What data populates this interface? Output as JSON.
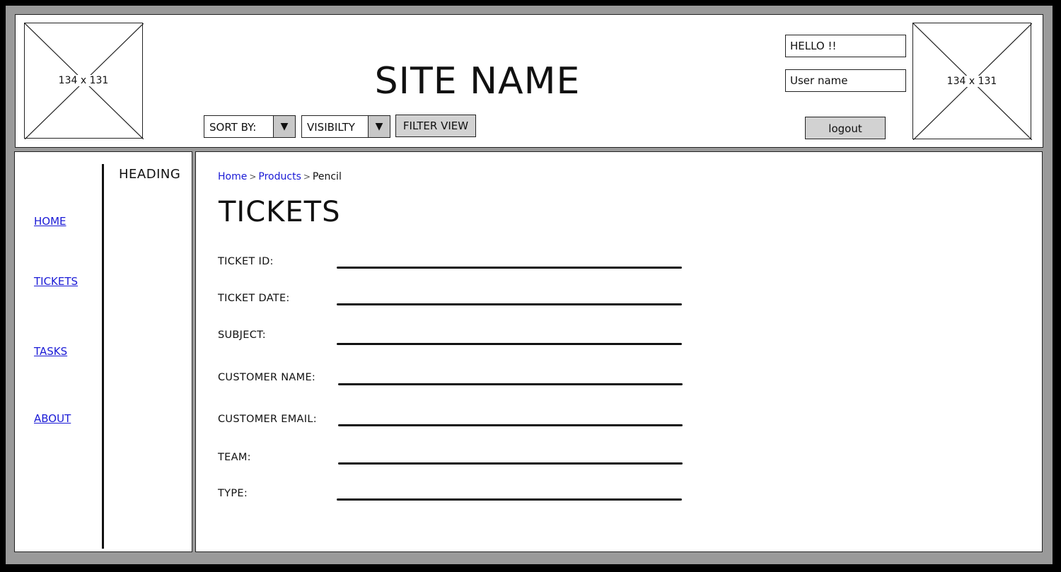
{
  "header": {
    "logo_left": {
      "label": "134 x 131"
    },
    "site_name": "SITE NAME",
    "sort_select": {
      "label": "SORT BY:",
      "arrow": "▼"
    },
    "visibility_select": {
      "label": "VISIBILTY",
      "arrow": "▼"
    },
    "filter_button": "FILTER VIEW",
    "greeting": "HELLO !!",
    "username": "User name",
    "logout_button": "logout",
    "avatar_right": {
      "label": "134 x 131"
    }
  },
  "sidebar": {
    "heading": "HEADING",
    "items": [
      {
        "label": "HOME"
      },
      {
        "label": "TICKETS"
      },
      {
        "label": "TASKS"
      },
      {
        "label": "ABOUT"
      }
    ]
  },
  "main": {
    "breadcrumb": [
      {
        "label": "Home",
        "link": true
      },
      {
        "label": "Products",
        "link": true
      },
      {
        "label": "Pencil",
        "link": false
      }
    ],
    "breadcrumb_separator": ">",
    "title": "TICKETS",
    "fields": [
      {
        "label": "TICKET ID:",
        "value": ""
      },
      {
        "label": "TICKET DATE:",
        "value": ""
      },
      {
        "label": "SUBJECT:",
        "value": ""
      },
      {
        "label": "CUSTOMER NAME:",
        "value": ""
      },
      {
        "label": "CUSTOMER EMAIL:",
        "value": ""
      },
      {
        "label": "TEAM:",
        "value": ""
      },
      {
        "label": "TYPE:",
        "value": ""
      }
    ]
  },
  "colors": {
    "frame": "#9a9a9a",
    "background": "#000000",
    "panel": "#ffffff",
    "link": "#1a1ad6",
    "button": "#d2d2d2"
  }
}
